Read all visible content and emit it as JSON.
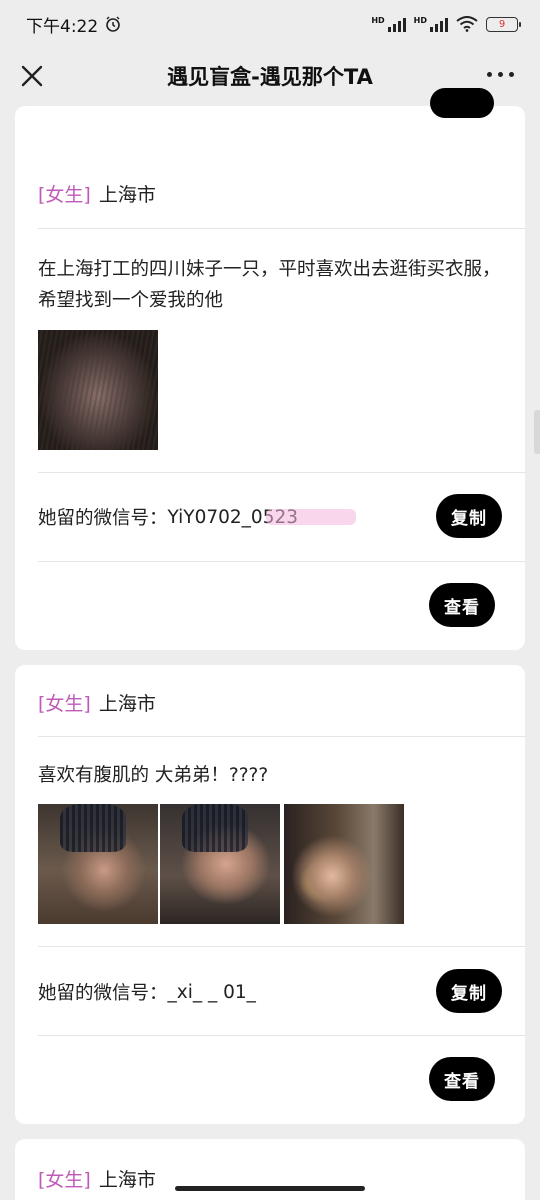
{
  "status_bar": {
    "time": "下午4:22",
    "battery": "9",
    "signal_label_1": "HD",
    "signal_label_2": "HD"
  },
  "nav": {
    "title": "遇见盲盒-遇见那个TA"
  },
  "cards": [
    {
      "gender": "[女生]",
      "city": "上海市",
      "description": "在上海打工的四川妹子一只，平时喜欢出去逛街买衣服，希望找到一个爱我的他",
      "wechat_label": "她留的微信号：",
      "wechat_value": "YiY0702_0523",
      "copy_label": "复制",
      "view_label": "查看"
    },
    {
      "gender": "[女生]",
      "city": "上海市",
      "description": "喜欢有腹肌的 大弟弟！????",
      "wechat_label": "她留的微信号：",
      "wechat_value": "_xi_ _ 01_",
      "copy_label": "复制",
      "view_label": "查看"
    },
    {
      "gender": "[女生]",
      "city": "上海市"
    }
  ],
  "colors": {
    "gender_tag": "#c05ab7",
    "button_bg": "#000000",
    "page_bg": "#ededed"
  }
}
